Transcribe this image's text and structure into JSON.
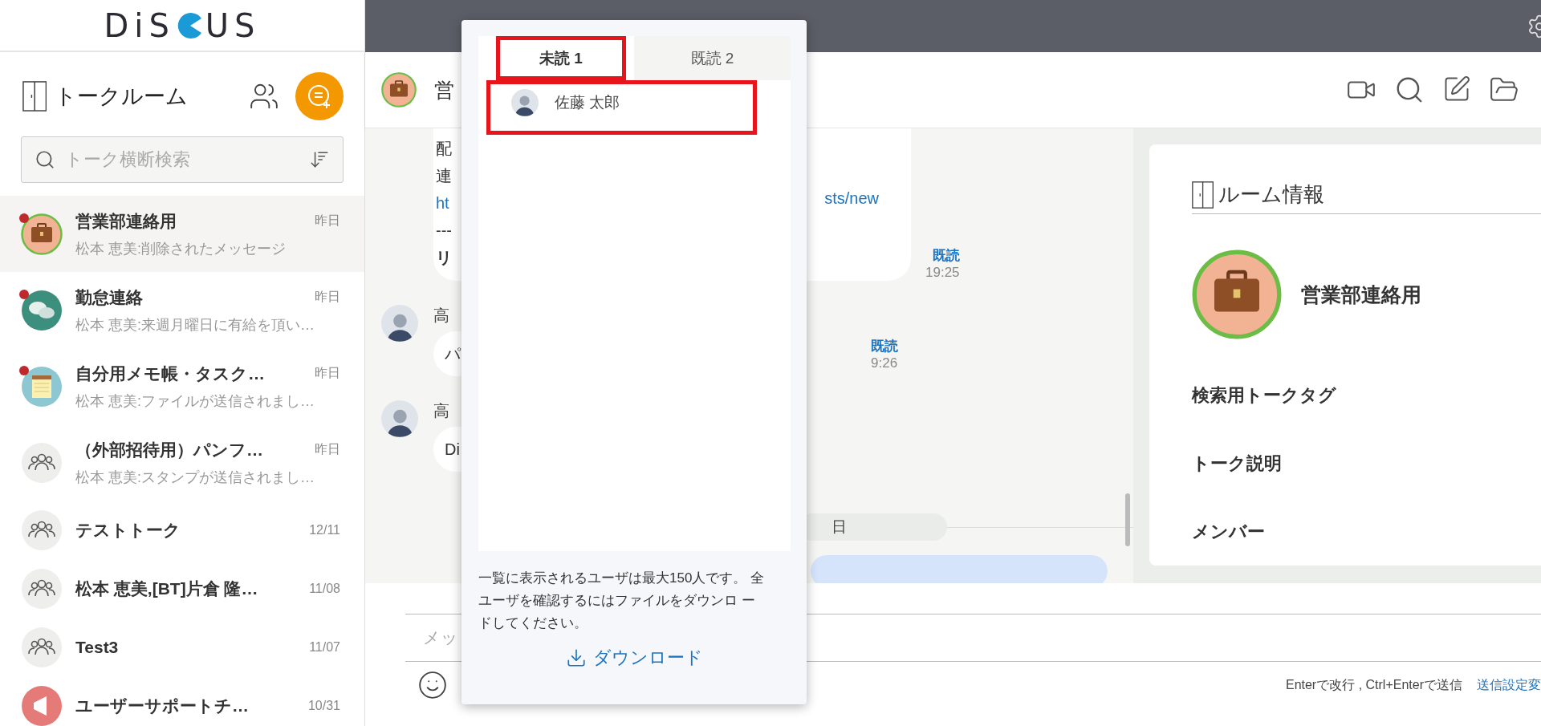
{
  "logo": {
    "left": "DiS",
    "right": "US"
  },
  "sidebar": {
    "title": "トークルーム",
    "search": {
      "placeholder": "トーク横断検索"
    },
    "rooms": [
      {
        "name": "営業部連絡用",
        "time": "昨日",
        "preview": "松本 恵美:削除されたメッセージ",
        "kind": "briefcase",
        "pinned": true,
        "selected": true
      },
      {
        "name": "勤怠連絡",
        "time": "昨日",
        "preview": "松本 恵美:来週月曜日に有給を頂い…",
        "kind": "chat",
        "pinned": true,
        "selected": false
      },
      {
        "name": "自分用メモ帳・タスク…",
        "time": "昨日",
        "preview": "松本 恵美:ファイルが送信されまし…",
        "kind": "notepad",
        "pinned": true,
        "selected": false
      },
      {
        "name": "（外部招待用）パンフ…",
        "time": "昨日",
        "preview": "松本 恵美:スタンプが送信されまし…",
        "kind": "group",
        "pinned": false,
        "selected": false
      },
      {
        "name": "テストトーク",
        "time": "12/11",
        "kind": "group",
        "pinned": false,
        "selected": false
      },
      {
        "name": "松本 恵美,[BT]片倉 隆…",
        "time": "11/08",
        "kind": "group",
        "pinned": false,
        "selected": false
      },
      {
        "name": "Test3",
        "time": "11/07",
        "kind": "group",
        "pinned": false,
        "selected": false
      },
      {
        "name": "ユーザーサポートチ…",
        "time": "10/31",
        "kind": "megaphone",
        "pinned": false,
        "selected": false
      }
    ]
  },
  "chat": {
    "title": "営",
    "message_1": {
      "lines": [
        {
          "text": "配",
          "kind": "text"
        },
        {
          "text": "連",
          "kind": "text"
        },
        {
          "text": "ht",
          "kind": "link"
        },
        {
          "text": "---",
          "kind": "text"
        },
        {
          "text": "リ",
          "kind": "bold"
        }
      ],
      "link_tail": "sts/new",
      "read": "既読",
      "time": "19:25"
    },
    "message_2": {
      "sender": "高",
      "bubble": "パ",
      "read": "既読",
      "time": "9:26"
    },
    "message_3": {
      "sender": "高",
      "bubble": "Di"
    },
    "date_divider": "日"
  },
  "room_info": {
    "title": "ルーム情報",
    "room_name": "営業部連絡用",
    "sections": [
      "検索用トークタグ",
      "トーク説明",
      "メンバー"
    ]
  },
  "composer": {
    "placeholder": "メッ",
    "hint": "Enterで改行 , Ctrl+Enterで送信",
    "settings_link": "送信設定変"
  },
  "read_popup": {
    "tabs": [
      {
        "label": "未読 1",
        "selected": true,
        "highlighted": true
      },
      {
        "label": "既読 2",
        "selected": false,
        "highlighted": false
      }
    ],
    "users": [
      {
        "name": "佐藤 太郎",
        "highlighted": true
      }
    ],
    "note": "一覧に表示されるユーザは最大150人です。 全ユーザを確認するにはファイルをダウンロ ードしてください。",
    "download": "ダウンロード"
  }
}
